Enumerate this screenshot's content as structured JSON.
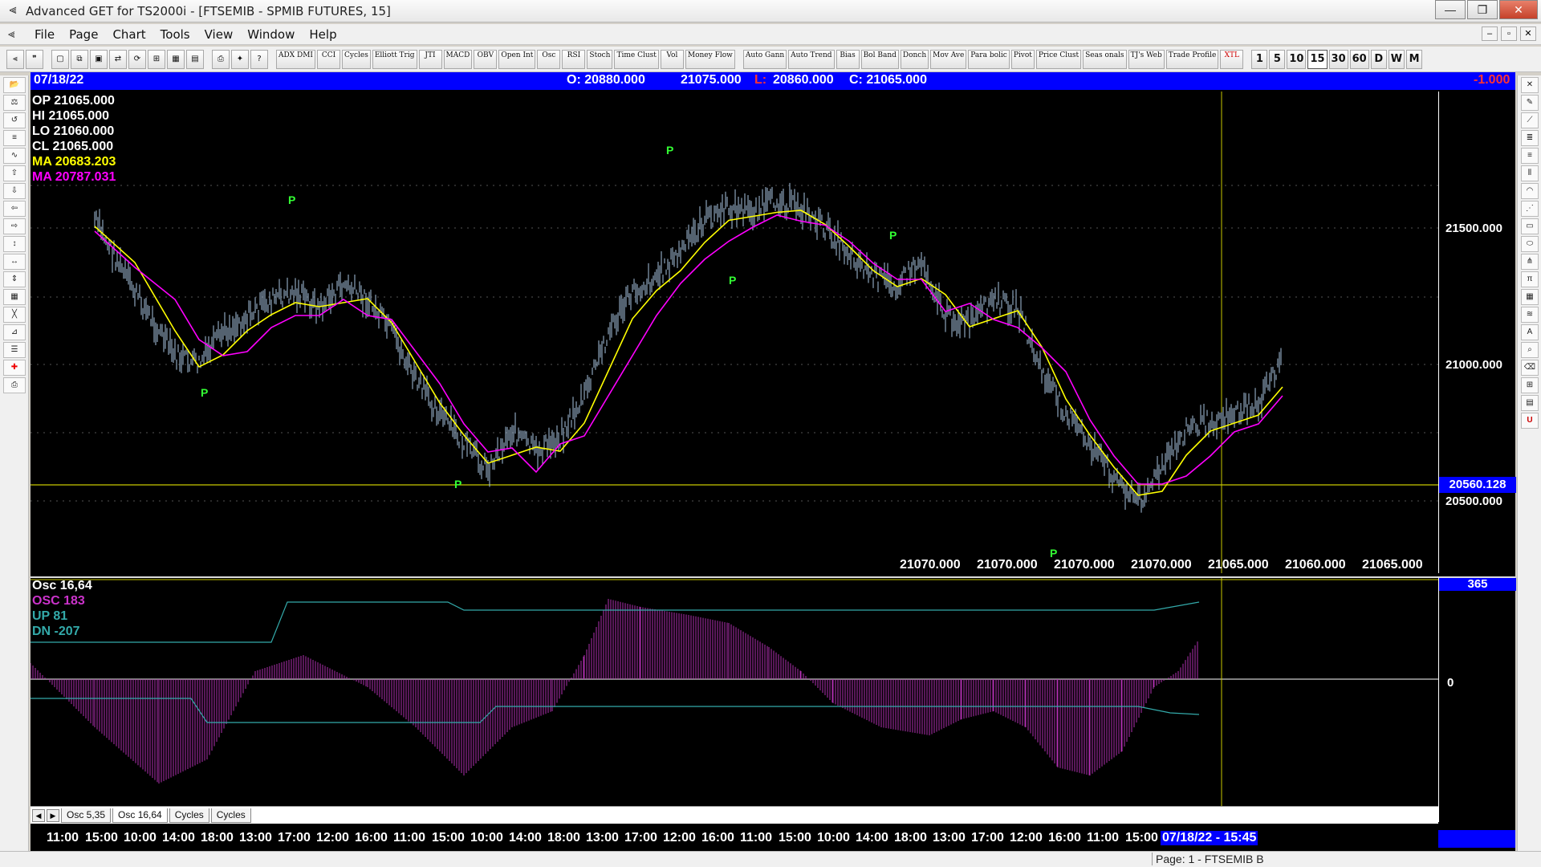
{
  "window": {
    "title": "Advanced GET for TS2000i - [FTSEMIB - SPMIB FUTURES, 15]",
    "app_icon": "app-icon",
    "minimize": "—",
    "maximize": "❒",
    "close": "✕"
  },
  "menu": {
    "items": [
      "File",
      "Page",
      "Chart",
      "Tools",
      "View",
      "Window",
      "Help"
    ]
  },
  "toolbar": {
    "studies": [
      "ADX DMI",
      "CCI",
      "Cycles",
      "Elliott Trig",
      "JTI",
      "MACD",
      "OBV",
      "Open Int",
      "Osc",
      "RSI",
      "Stoch",
      "Time Clust",
      "Vol",
      "Money Flow",
      "Auto Gann",
      "Auto Trend",
      "Bias",
      "Bol Band",
      "Donch",
      "Mov Ave",
      "Para bolic",
      "Pivot",
      "Price Clust",
      "Seas onals",
      "TJ's Web",
      "Trade Profile",
      "XTL"
    ],
    "timeframes": [
      "1",
      "5",
      "10",
      "15",
      "30",
      "60",
      "D",
      "W",
      "M"
    ],
    "active_timeframe": "15"
  },
  "infobar": {
    "date": "07/18/22",
    "open": "O: 20880.000",
    "high": "21075.000",
    "low_label": "L:",
    "low": "20860.000",
    "close": "C: 21065.000",
    "change": "-1.000"
  },
  "legend": {
    "op": "OP  21065.000",
    "hi": "HI   21065.000",
    "lo": "LO  21060.000",
    "cl": "CL  21065.000",
    "ma1": "MA  20683.203",
    "ma2": "MA  20787.031",
    "ma1_color": "#ffff00",
    "ma2_color": "#ff00ff"
  },
  "price_axis": {
    "labels": [
      "21500.000",
      "21000.000",
      "20500.000"
    ],
    "highlight": "20560.128",
    "pivot_marker": "P"
  },
  "bottom_values": [
    "21070.000",
    "21070.000",
    "21070.000",
    "21070.000",
    "21065.000",
    "21060.000",
    "21065.000"
  ],
  "oscillator": {
    "title": "Osc 16,64",
    "osc": "OSC 183",
    "up": "UP   81",
    "dn": "DN   -207",
    "top_label": "365",
    "zero_label": "0",
    "osc_color": "#cc33cc",
    "band_color": "#33aaaa"
  },
  "tabs": [
    "Osc 5,35",
    "Osc 16,64",
    "Cycles",
    "Cycles"
  ],
  "tab_arrows": [
    "◀",
    "▶"
  ],
  "time_axis": {
    "labels": [
      "11:00",
      "15:00",
      "10:00",
      "14:00",
      "18:00",
      "13:00",
      "17:00",
      "12:00",
      "16:00",
      "11:00",
      "15:00",
      "10:00",
      "14:00",
      "18:00",
      "13:00",
      "17:00",
      "12:00",
      "16:00",
      "11:00",
      "15:00",
      "10:00",
      "14:00",
      "18:00",
      "13:00",
      "17:00",
      "12:00",
      "16:00",
      "11:00",
      "15:00"
    ],
    "current": "07/18/22 - 15:45"
  },
  "status": {
    "page": "Page: 1 - FTSEMIB B"
  }
}
